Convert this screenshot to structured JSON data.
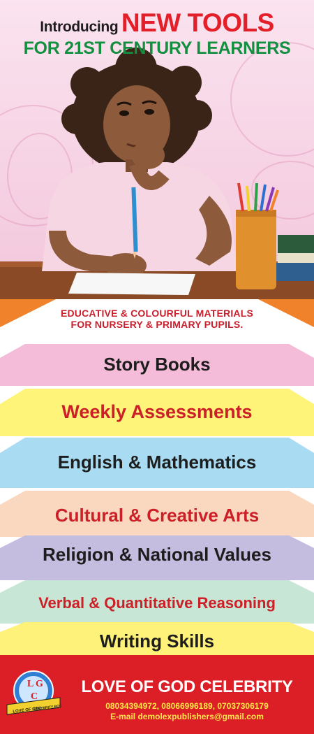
{
  "headline": {
    "intro": "Introducing",
    "new_tools": "NEW TOOLS",
    "subtitle": "FOR 21ST CENTURY LEARNERS"
  },
  "tagline": {
    "line1": "EDUCATIVE & COLOURFUL MATERIALS",
    "line2": "FOR NURSERY & PRIMARY PUPILS."
  },
  "subjects": [
    {
      "label": "Story Books",
      "bg": "#f4bcd8",
      "fg": "#1d1d1d"
    },
    {
      "label": "Weekly Assessments",
      "bg": "#fff47a",
      "fg": "#cc2028"
    },
    {
      "label": "English & Mathematics",
      "bg": "#a9dcf3",
      "fg": "#1d1d1d"
    },
    {
      "label": "Cultural & Creative Arts",
      "bg": "#fad7bf",
      "fg": "#cc2028"
    },
    {
      "label": "Religion & National Values",
      "bg": "#c5bde0",
      "fg": "#1d1d1d"
    },
    {
      "label": "Verbal & Quantitative Reasoning",
      "bg": "#c8e6d6",
      "fg": "#cc2028"
    },
    {
      "label": "Writing Skills",
      "bg": "#fff27a",
      "fg": "#1d1d1d"
    }
  ],
  "footer": {
    "brand": "LOVE OF GOD CELEBRITY",
    "phones": "08034394972, 08066996189, 07037306179",
    "email": "E-mail demolexpublishers@gmail.com",
    "logo_initials": [
      "L",
      "G",
      "C"
    ],
    "logo_banner": "LOVE OF GOD",
    "logo_banner2": "CELEBRITY BOOKS"
  },
  "colors": {
    "headline_red": "#e3202a",
    "headline_green": "#12903f",
    "footer_red": "#dc1f26",
    "footer_yellow": "#ffe74a",
    "accent_orange": "#f0822b"
  }
}
